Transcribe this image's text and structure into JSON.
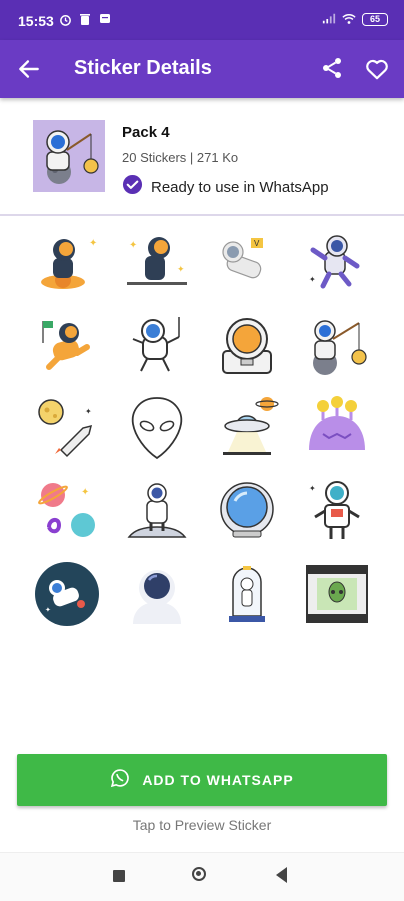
{
  "status_bar": {
    "time": "15:53",
    "battery": "65"
  },
  "app_bar": {
    "title": "Sticker Details"
  },
  "pack": {
    "name": "Pack 4",
    "meta": "20 Stickers | 271 Ko",
    "status": "Ready to use in WhatsApp"
  },
  "stickers": [
    "astronaut-sitting-on-planet",
    "astronaut-sitting-on-ground",
    "astronaut-floating-with-flag",
    "astronaut-spacewalk",
    "astronaut-holding-flag",
    "astronaut-floating",
    "astronaut-helmet-front",
    "astronaut-fishing-on-moon",
    "moon-and-rocket",
    "alien-head-outline",
    "ufo",
    "purple-alien",
    "planets-galaxy",
    "astronaut-on-moon",
    "space-helmet",
    "astronaut-on-grid",
    "astronaut-in-circle",
    "astronaut-bust",
    "astronaut-capsule",
    "alien-on-film"
  ],
  "actions": {
    "add_label": "ADD TO WHATSAPP",
    "hint": "Tap to Preview Sticker"
  },
  "colors": {
    "status_bar": "#5a2fb4",
    "app_bar": "#6a3bc4",
    "add_button": "#3fb947",
    "check": "#5a2fb4"
  }
}
